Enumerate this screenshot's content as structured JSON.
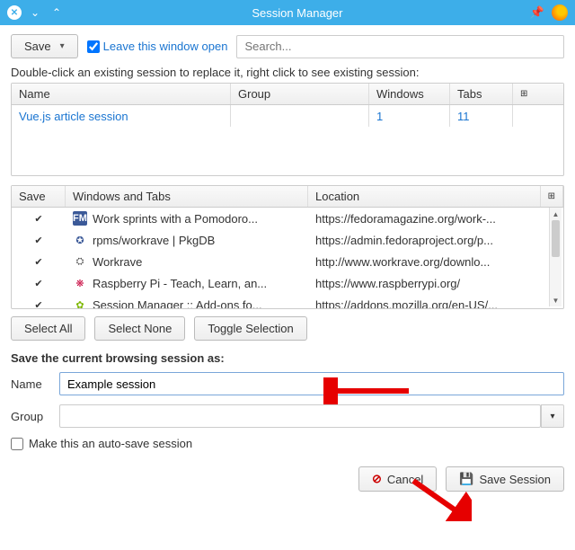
{
  "titlebar": {
    "title": "Session Manager"
  },
  "toolbar": {
    "save_label": "Save",
    "leave_open_label": "Leave this window open",
    "leave_open_checked": true,
    "search_placeholder": "Search..."
  },
  "instruction": "Double-click an existing session to replace it, right click to see existing session:",
  "sessions": {
    "headers": {
      "name": "Name",
      "group": "Group",
      "windows": "Windows",
      "tabs": "Tabs"
    },
    "rows": [
      {
        "name": "Vue.js article session",
        "group": "",
        "windows": "1",
        "tabs": "11"
      }
    ]
  },
  "tabs": {
    "headers": {
      "save": "Save",
      "wt": "Windows and Tabs",
      "location": "Location"
    },
    "rows": [
      {
        "checked": true,
        "favicon": "fm",
        "title": "Work sprints with a Pomodoro...",
        "location": "https://fedoramagazine.org/work-..."
      },
      {
        "checked": true,
        "favicon": "pkg",
        "title": "rpms/workrave | PkgDB",
        "location": "https://admin.fedoraproject.org/p..."
      },
      {
        "checked": true,
        "favicon": "wr",
        "title": "Workrave",
        "location": "http://www.workrave.org/downlo..."
      },
      {
        "checked": true,
        "favicon": "rpi",
        "title": "Raspberry Pi - Teach, Learn, an...",
        "location": "https://www.raspberrypi.org/"
      },
      {
        "checked": true,
        "favicon": "sm",
        "title": "Session Manager :: Add-ons fo...",
        "location": "https://addons.mozilla.org/en-US/..."
      }
    ]
  },
  "selection": {
    "select_all": "Select All",
    "select_none": "Select None",
    "toggle": "Toggle Selection"
  },
  "form": {
    "heading": "Save the current browsing session as:",
    "name_label": "Name",
    "name_value": "Example session",
    "group_label": "Group",
    "group_value": "",
    "autosave_label": "Make this an auto-save session",
    "autosave_checked": false
  },
  "footer": {
    "cancel": "Cancel",
    "save_session": "Save Session"
  }
}
